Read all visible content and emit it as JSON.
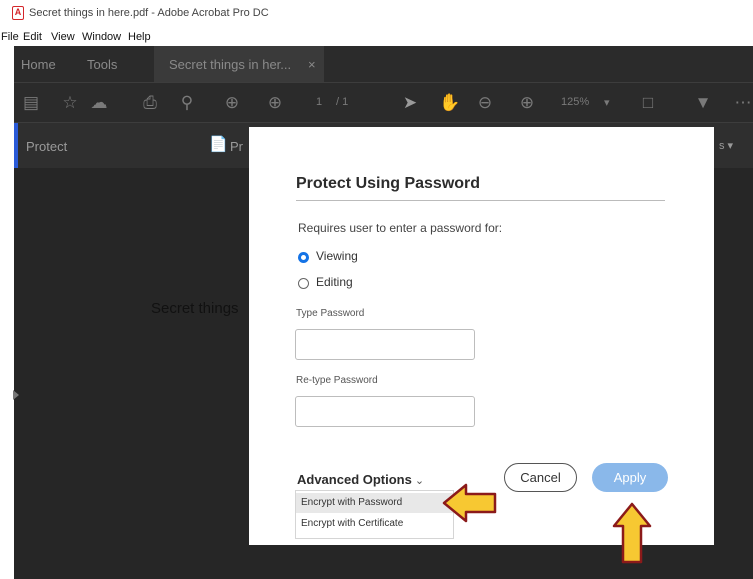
{
  "window": {
    "title": "Secret things in here.pdf - Adobe Acrobat Pro DC"
  },
  "menu": [
    "File",
    "Edit",
    "View",
    "Window",
    "Help"
  ],
  "tabs": {
    "home": "Home",
    "tools": "Tools",
    "document": "Secret things in her...",
    "close": "×"
  },
  "toolbar": {
    "page_current": "1",
    "page_total": "/ 1",
    "zoom": "125%"
  },
  "protect_bar": {
    "label": "Protect",
    "partial_left": "Pr",
    "partial_right": "s ▾"
  },
  "document": {
    "text": "Secret things"
  },
  "dialog": {
    "title": "Protect Using Password",
    "subtitle": "Requires user to enter a password for:",
    "options": [
      {
        "label": "Viewing",
        "selected": true
      },
      {
        "label": "Editing",
        "selected": false
      }
    ],
    "password_label": "Type Password",
    "password_value": "",
    "retype_label": "Re-type Password",
    "retype_value": "",
    "advanced_label": "Advanced Options",
    "advanced_items": [
      "Encrypt with Password",
      "Encrypt with Certificate"
    ],
    "cancel_label": "Cancel",
    "apply_label": "Apply"
  },
  "colors": {
    "accent": "#1473e6",
    "apply": "#8ab8ea",
    "annotation_fill": "#f7c832",
    "annotation_stroke": "#8b1a1a",
    "app_dark": "#2b2b2b"
  }
}
